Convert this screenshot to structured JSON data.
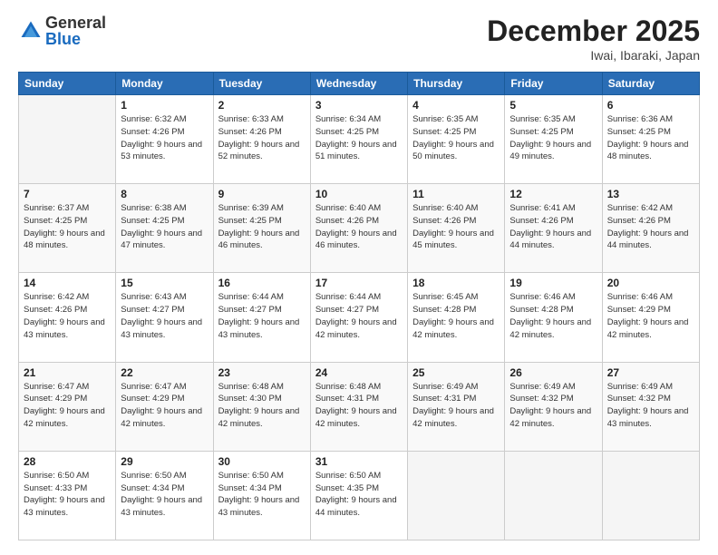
{
  "logo": {
    "general": "General",
    "blue": "Blue"
  },
  "header": {
    "month": "December 2025",
    "location": "Iwai, Ibaraki, Japan"
  },
  "weekdays": [
    "Sunday",
    "Monday",
    "Tuesday",
    "Wednesday",
    "Thursday",
    "Friday",
    "Saturday"
  ],
  "weeks": [
    [
      {
        "day": "",
        "sunrise": "",
        "sunset": "",
        "daylight": "",
        "empty": true
      },
      {
        "day": "1",
        "sunrise": "Sunrise: 6:32 AM",
        "sunset": "Sunset: 4:26 PM",
        "daylight": "Daylight: 9 hours and 53 minutes."
      },
      {
        "day": "2",
        "sunrise": "Sunrise: 6:33 AM",
        "sunset": "Sunset: 4:26 PM",
        "daylight": "Daylight: 9 hours and 52 minutes."
      },
      {
        "day": "3",
        "sunrise": "Sunrise: 6:34 AM",
        "sunset": "Sunset: 4:25 PM",
        "daylight": "Daylight: 9 hours and 51 minutes."
      },
      {
        "day": "4",
        "sunrise": "Sunrise: 6:35 AM",
        "sunset": "Sunset: 4:25 PM",
        "daylight": "Daylight: 9 hours and 50 minutes."
      },
      {
        "day": "5",
        "sunrise": "Sunrise: 6:35 AM",
        "sunset": "Sunset: 4:25 PM",
        "daylight": "Daylight: 9 hours and 49 minutes."
      },
      {
        "day": "6",
        "sunrise": "Sunrise: 6:36 AM",
        "sunset": "Sunset: 4:25 PM",
        "daylight": "Daylight: 9 hours and 48 minutes."
      }
    ],
    [
      {
        "day": "7",
        "sunrise": "Sunrise: 6:37 AM",
        "sunset": "Sunset: 4:25 PM",
        "daylight": "Daylight: 9 hours and 48 minutes."
      },
      {
        "day": "8",
        "sunrise": "Sunrise: 6:38 AM",
        "sunset": "Sunset: 4:25 PM",
        "daylight": "Daylight: 9 hours and 47 minutes."
      },
      {
        "day": "9",
        "sunrise": "Sunrise: 6:39 AM",
        "sunset": "Sunset: 4:25 PM",
        "daylight": "Daylight: 9 hours and 46 minutes."
      },
      {
        "day": "10",
        "sunrise": "Sunrise: 6:40 AM",
        "sunset": "Sunset: 4:26 PM",
        "daylight": "Daylight: 9 hours and 46 minutes."
      },
      {
        "day": "11",
        "sunrise": "Sunrise: 6:40 AM",
        "sunset": "Sunset: 4:26 PM",
        "daylight": "Daylight: 9 hours and 45 minutes."
      },
      {
        "day": "12",
        "sunrise": "Sunrise: 6:41 AM",
        "sunset": "Sunset: 4:26 PM",
        "daylight": "Daylight: 9 hours and 44 minutes."
      },
      {
        "day": "13",
        "sunrise": "Sunrise: 6:42 AM",
        "sunset": "Sunset: 4:26 PM",
        "daylight": "Daylight: 9 hours and 44 minutes."
      }
    ],
    [
      {
        "day": "14",
        "sunrise": "Sunrise: 6:42 AM",
        "sunset": "Sunset: 4:26 PM",
        "daylight": "Daylight: 9 hours and 43 minutes."
      },
      {
        "day": "15",
        "sunrise": "Sunrise: 6:43 AM",
        "sunset": "Sunset: 4:27 PM",
        "daylight": "Daylight: 9 hours and 43 minutes."
      },
      {
        "day": "16",
        "sunrise": "Sunrise: 6:44 AM",
        "sunset": "Sunset: 4:27 PM",
        "daylight": "Daylight: 9 hours and 43 minutes."
      },
      {
        "day": "17",
        "sunrise": "Sunrise: 6:44 AM",
        "sunset": "Sunset: 4:27 PM",
        "daylight": "Daylight: 9 hours and 42 minutes."
      },
      {
        "day": "18",
        "sunrise": "Sunrise: 6:45 AM",
        "sunset": "Sunset: 4:28 PM",
        "daylight": "Daylight: 9 hours and 42 minutes."
      },
      {
        "day": "19",
        "sunrise": "Sunrise: 6:46 AM",
        "sunset": "Sunset: 4:28 PM",
        "daylight": "Daylight: 9 hours and 42 minutes."
      },
      {
        "day": "20",
        "sunrise": "Sunrise: 6:46 AM",
        "sunset": "Sunset: 4:29 PM",
        "daylight": "Daylight: 9 hours and 42 minutes."
      }
    ],
    [
      {
        "day": "21",
        "sunrise": "Sunrise: 6:47 AM",
        "sunset": "Sunset: 4:29 PM",
        "daylight": "Daylight: 9 hours and 42 minutes."
      },
      {
        "day": "22",
        "sunrise": "Sunrise: 6:47 AM",
        "sunset": "Sunset: 4:29 PM",
        "daylight": "Daylight: 9 hours and 42 minutes."
      },
      {
        "day": "23",
        "sunrise": "Sunrise: 6:48 AM",
        "sunset": "Sunset: 4:30 PM",
        "daylight": "Daylight: 9 hours and 42 minutes."
      },
      {
        "day": "24",
        "sunrise": "Sunrise: 6:48 AM",
        "sunset": "Sunset: 4:31 PM",
        "daylight": "Daylight: 9 hours and 42 minutes."
      },
      {
        "day": "25",
        "sunrise": "Sunrise: 6:49 AM",
        "sunset": "Sunset: 4:31 PM",
        "daylight": "Daylight: 9 hours and 42 minutes."
      },
      {
        "day": "26",
        "sunrise": "Sunrise: 6:49 AM",
        "sunset": "Sunset: 4:32 PM",
        "daylight": "Daylight: 9 hours and 42 minutes."
      },
      {
        "day": "27",
        "sunrise": "Sunrise: 6:49 AM",
        "sunset": "Sunset: 4:32 PM",
        "daylight": "Daylight: 9 hours and 43 minutes."
      }
    ],
    [
      {
        "day": "28",
        "sunrise": "Sunrise: 6:50 AM",
        "sunset": "Sunset: 4:33 PM",
        "daylight": "Daylight: 9 hours and 43 minutes."
      },
      {
        "day": "29",
        "sunrise": "Sunrise: 6:50 AM",
        "sunset": "Sunset: 4:34 PM",
        "daylight": "Daylight: 9 hours and 43 minutes."
      },
      {
        "day": "30",
        "sunrise": "Sunrise: 6:50 AM",
        "sunset": "Sunset: 4:34 PM",
        "daylight": "Daylight: 9 hours and 43 minutes."
      },
      {
        "day": "31",
        "sunrise": "Sunrise: 6:50 AM",
        "sunset": "Sunset: 4:35 PM",
        "daylight": "Daylight: 9 hours and 44 minutes."
      },
      {
        "day": "",
        "sunrise": "",
        "sunset": "",
        "daylight": "",
        "empty": true
      },
      {
        "day": "",
        "sunrise": "",
        "sunset": "",
        "daylight": "",
        "empty": true
      },
      {
        "day": "",
        "sunrise": "",
        "sunset": "",
        "daylight": "",
        "empty": true
      }
    ]
  ]
}
